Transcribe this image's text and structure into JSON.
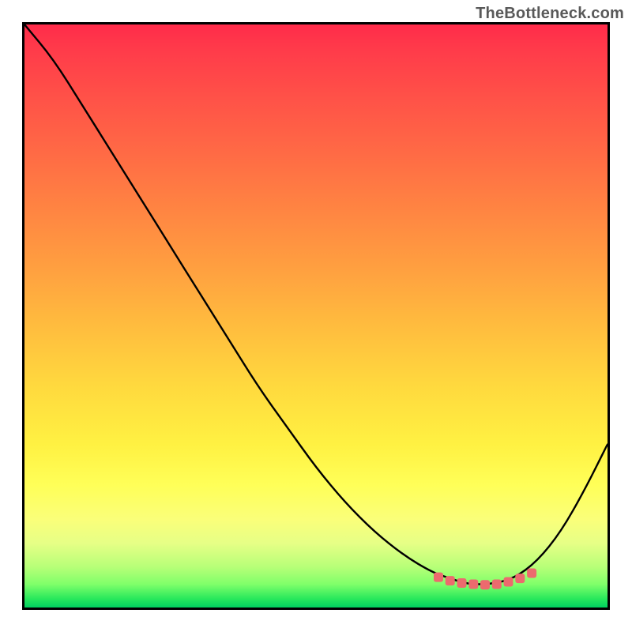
{
  "watermark": "TheBottleneck.com",
  "chart_data": {
    "type": "line",
    "title": "",
    "xlabel": "",
    "ylabel": "",
    "xlim": [
      0,
      100
    ],
    "ylim": [
      0,
      100
    ],
    "series": [
      {
        "name": "black-curve",
        "color": "#000000",
        "x": [
          0,
          5,
          10,
          15,
          20,
          25,
          30,
          35,
          40,
          45,
          50,
          55,
          60,
          65,
          70,
          73,
          76,
          80,
          84,
          88,
          92,
          96,
          100
        ],
        "y": [
          100,
          94,
          86,
          78,
          70,
          62,
          54,
          46,
          38,
          31,
          24,
          18,
          13,
          9,
          6,
          5,
          4,
          4,
          5,
          8,
          13,
          20,
          28
        ]
      },
      {
        "name": "red-marker-band",
        "color": "#ec6a6e",
        "type": "scatter",
        "x": [
          71,
          73,
          75,
          77,
          79,
          81,
          83,
          85,
          87
        ],
        "y": [
          5.2,
          4.6,
          4.2,
          4.0,
          3.9,
          4.0,
          4.4,
          5.0,
          5.9
        ]
      }
    ],
    "background_gradient": {
      "top": "#ff2b4a",
      "mid": "#fff142",
      "bottom": "#00d060"
    }
  }
}
